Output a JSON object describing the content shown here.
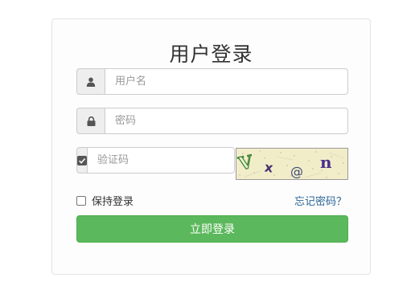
{
  "login_form": {
    "title": "用户登录",
    "username": {
      "placeholder": "用户名",
      "value": "",
      "icon": "user-icon"
    },
    "password": {
      "placeholder": "密码",
      "value": "",
      "icon": "lock-icon"
    },
    "captcha": {
      "placeholder": "验证码",
      "value": "",
      "icon": "checkbox-icon",
      "image_chars": [
        "V",
        "x",
        "@",
        "n"
      ]
    },
    "remember_label": "保持登录",
    "remember_checked": false,
    "forgot_label": "忘记密码？",
    "submit_label": "立即登录"
  },
  "colors": {
    "primary_button": "#5cb85c",
    "link": "#2a6496",
    "addon_bg": "#eeeeee",
    "captcha_bg": "#f2edc9"
  }
}
